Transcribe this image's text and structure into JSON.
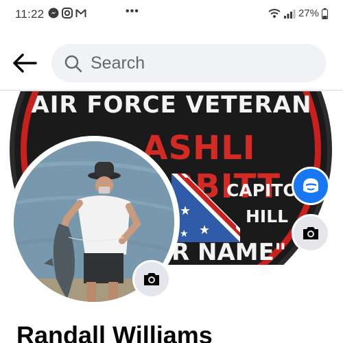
{
  "status_bar": {
    "time": "11:22",
    "battery": "27%",
    "icons_left": [
      "messenger-icon",
      "instagram-icon",
      "gmail-icon"
    ],
    "more": "•••"
  },
  "top_bar": {
    "search_placeholder": "Search"
  },
  "cover": {
    "line1": "AIR FORCE VETERAN",
    "line2": "ASHLI BABBITT",
    "line3": "CAPITOL",
    "line4": "HILL",
    "line5": "R NAME\""
  },
  "profile": {
    "name": "Randall Williams"
  },
  "colors": {
    "accent": "#1877f2",
    "search_bg": "#f0f2f5",
    "patch_red": "#c8201d"
  }
}
